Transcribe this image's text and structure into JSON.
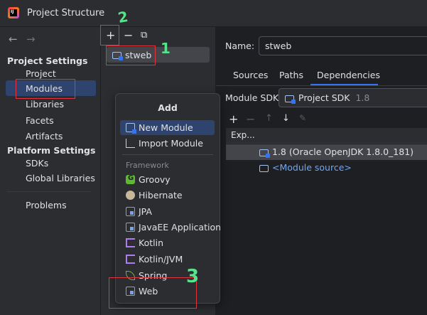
{
  "window": {
    "title": "Project Structure",
    "icon": "intellij-app-icon"
  },
  "nav": {
    "back": "←",
    "forward": "→",
    "project_settings": "Project Settings",
    "items1": [
      "Project",
      "Modules",
      "Libraries",
      "Facets",
      "Artifacts"
    ],
    "platform_settings": "Platform Settings",
    "items2": [
      "SDKs",
      "Global Libraries"
    ],
    "problems": "Problems"
  },
  "toolbar": {
    "add": "+",
    "remove": "−",
    "copy": "⧉"
  },
  "module": {
    "name": "stweb"
  },
  "details": {
    "name_label": "Name:",
    "name_value": "stweb",
    "tabs": [
      "Sources",
      "Paths",
      "Dependencies"
    ],
    "active_tab": "Dependencies",
    "sdk_label": "Module SDK:",
    "sdk_value": "Project SDK",
    "sdk_version": "1.8",
    "dep_tools": [
      "+",
      "−",
      "↑",
      "↓",
      "✎"
    ],
    "dep_header": "Exp...",
    "dep_rows": [
      "1.8 (Oracle OpenJDK 1.8.0_181)",
      "<Module source>"
    ]
  },
  "popup": {
    "title": "Add",
    "items": [
      "New Module",
      "Import Module"
    ],
    "group_label": "Framework",
    "frameworks": [
      "Groovy",
      "Hibernate",
      "JPA",
      "JavaEE Application",
      "Kotlin",
      "Kotlin/JVM",
      "Spring",
      "Web"
    ]
  },
  "annotations": {
    "step1": "1",
    "step2": "2",
    "step3": "3"
  },
  "colors": {
    "accent": "#3574f0",
    "selection": "#2e436e",
    "annotation_red": "#e0353e",
    "annotation_green": "#57e38b"
  }
}
